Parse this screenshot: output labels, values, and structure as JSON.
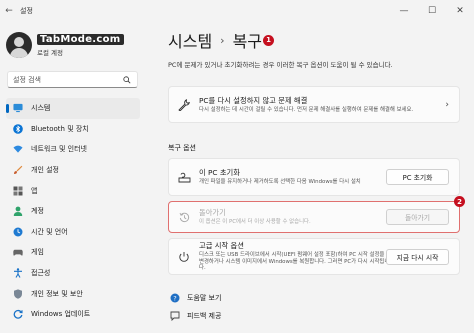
{
  "window": {
    "title": "설정",
    "controls": [
      "—",
      "☐",
      "✕"
    ]
  },
  "profile": {
    "watermark": "TabMode.com",
    "account_type": "로컬 계정"
  },
  "search": {
    "placeholder": "설정 검색"
  },
  "sidebar": {
    "items": [
      {
        "label": "시스템",
        "icon": "monitor-icon",
        "active": true
      },
      {
        "label": "Bluetooth 및 장치",
        "icon": "bluetooth-icon"
      },
      {
        "label": "네트워크 및 인터넷",
        "icon": "wifi-icon"
      },
      {
        "label": "개인 설정",
        "icon": "brush-icon"
      },
      {
        "label": "앱",
        "icon": "apps-icon"
      },
      {
        "label": "계정",
        "icon": "person-icon"
      },
      {
        "label": "시간 및 언어",
        "icon": "globe-clock-icon"
      },
      {
        "label": "게임",
        "icon": "gamepad-icon"
      },
      {
        "label": "접근성",
        "icon": "accessibility-icon"
      },
      {
        "label": "개인 정보 및 보안",
        "icon": "shield-icon"
      },
      {
        "label": "Windows 업데이트",
        "icon": "update-icon"
      }
    ]
  },
  "header": {
    "breadcrumb_parent": "시스템",
    "separator": "›",
    "current": "복구",
    "annotation_1": "1",
    "description": "PC에 문제가 있거나 초기화하려는 경우 이러한 복구 옵션이 도움이 될 수 있습니다."
  },
  "troubleshoot": {
    "title": "PC를 다시 설정하지 않고 문제 해결",
    "subtitle": "다시 설정하는 데 시간이 걸릴 수 있습니다. 먼저 문제 해결사를 실행하여 문제를 해결해 보세요."
  },
  "recovery_options": {
    "section_label": "복구 옵션",
    "reset": {
      "title": "이 PC 초기화",
      "subtitle": "개인 파일을 유지하거나 제거하도록 선택한 다음 Windows를 다시 설치",
      "button": "PC 초기화"
    },
    "go_back": {
      "title": "돌아가기",
      "subtitle": "이 옵션은 이 PC에서 더 이상 사용할 수 없습니다.",
      "button": "돌아가기",
      "annotation_2": "2"
    },
    "advanced": {
      "title": "고급 시작 옵션",
      "subtitle": "디스크 또는 USB 드라이브에서 시작(UEFI 펌웨어 설정 포함)하여 PC 시작 설정을 변경하거나 시스템 이미지에서 Windows를 복원합니다. 그러면 PC가 다시 시작됩니다.",
      "button": "지금 다시 시작"
    }
  },
  "footer_links": [
    {
      "label": "도움말 보기",
      "icon": "help-icon"
    },
    {
      "label": "피드백 제공",
      "icon": "feedback-icon"
    }
  ],
  "colors": {
    "accent": "#0067c0",
    "annotation_red": "#c50f1f"
  }
}
